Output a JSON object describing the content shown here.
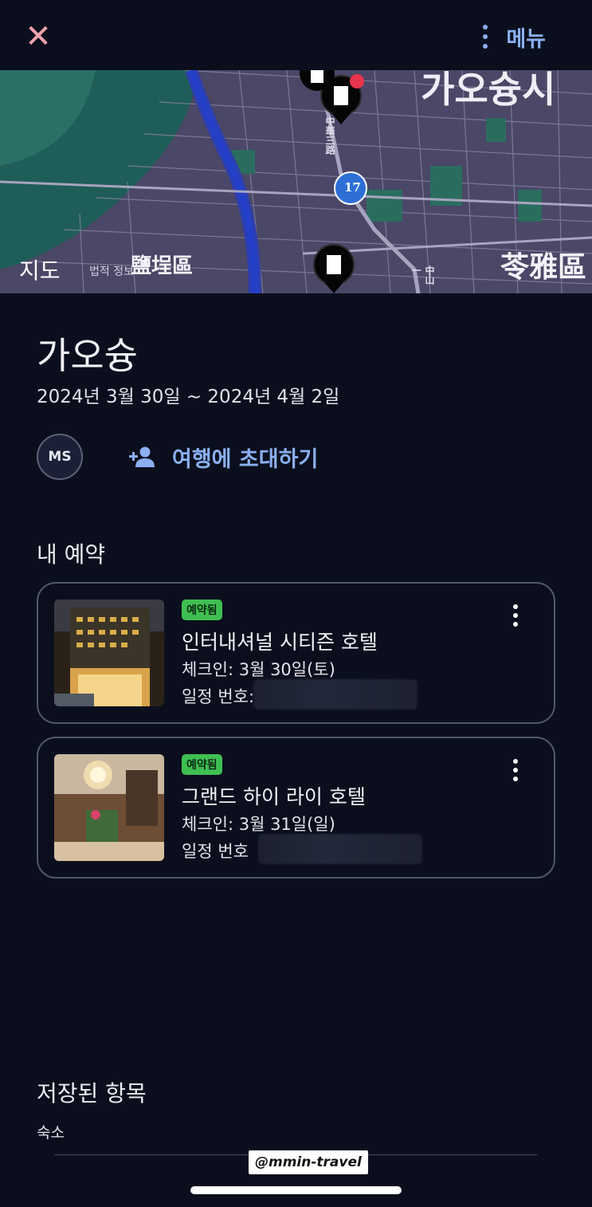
{
  "topbar": {
    "close_icon": "close-icon",
    "menu_icon": "more-vertical-icon",
    "menu_label": "메뉴"
  },
  "map": {
    "brand": "지도",
    "legal": "법적 정보",
    "district_left": "鹽埕區",
    "district_right": "苓雅區",
    "top_label": "가오슝시",
    "road_label": "中華三路",
    "road_label_2": "中山一",
    "route_shield": "17",
    "pins": [
      "hotel-pin-icon",
      "hotel-pin-icon",
      "hotel-pin-icon"
    ]
  },
  "trip": {
    "title": "가오슝",
    "dates": "2024년 3월 30일 ~ 2024년 4월 2일",
    "avatar_initials": "MS",
    "invite_label": "여행에 초대하기"
  },
  "reservations": {
    "title": "내 예약",
    "items": [
      {
        "badge": "예약됨",
        "name": "인터내셔널 시티즌 호텔",
        "checkin": "체크인: 3월 30일(토)",
        "itinerary": "일정 번호:",
        "image": "hotel-exterior-night-photo"
      },
      {
        "badge": "예약됨",
        "name": "그랜드 하이 라이 호텔",
        "checkin": "체크인: 3월 31일(일)",
        "itinerary": "일정 번호",
        "image": "hotel-lobby-chandelier-photo"
      }
    ]
  },
  "saved": {
    "title": "저장된 항목",
    "subtitle": "숙소"
  },
  "watermark": "@mmin-travel",
  "colors": {
    "background": "#0b0f1d",
    "accent": "#8ab0f2",
    "close": "#f2a3ad",
    "badge": "#3fbf52",
    "card_border": "#50566b"
  }
}
